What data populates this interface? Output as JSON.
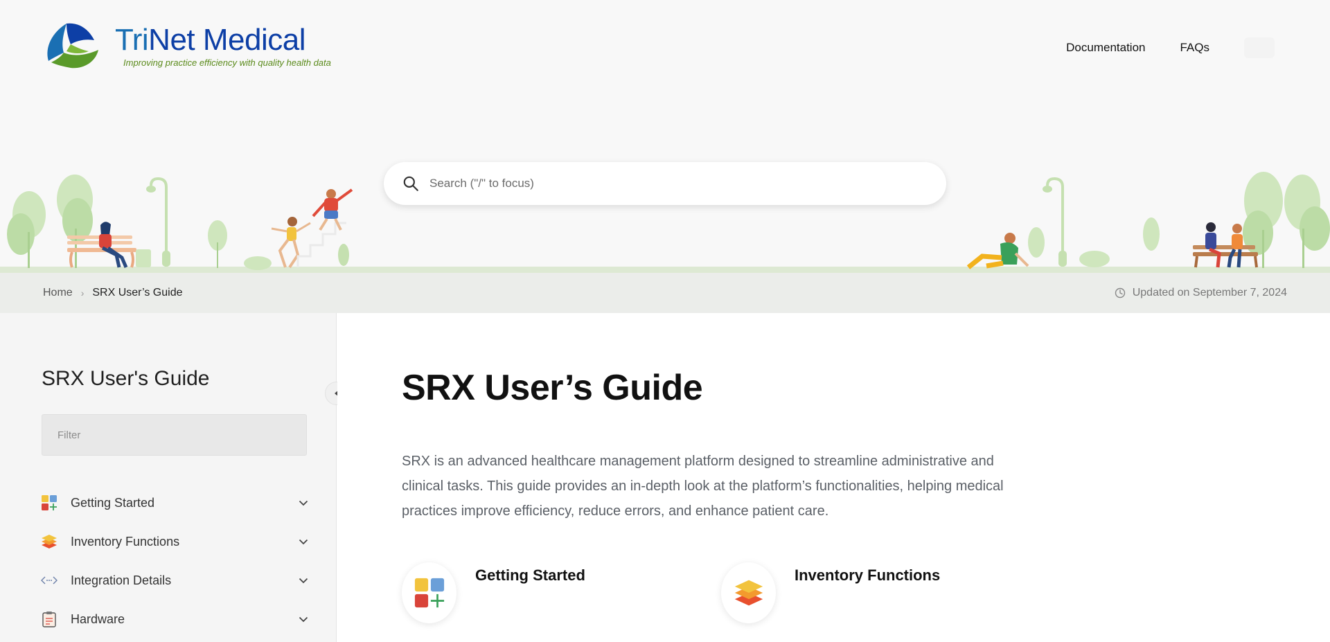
{
  "header": {
    "logo_title_prefix": "Tri",
    "logo_title_rest": "Net Medical",
    "logo_tagline": "Improving practice efficiency with quality health data",
    "nav": [
      {
        "label": "Documentation"
      },
      {
        "label": "FAQs"
      }
    ]
  },
  "search": {
    "placeholder": "Search (\"/\" to focus)",
    "icon": "search-icon"
  },
  "breadcrumb": {
    "home": "Home",
    "separator": "›",
    "current": "SRX User’s Guide",
    "updated": "Updated on September 7, 2024"
  },
  "sidebar": {
    "title": "SRX User's Guide",
    "filter_placeholder": "Filter",
    "items": [
      {
        "label": "Getting Started",
        "icon": "blocks-icon"
      },
      {
        "label": "Inventory Functions",
        "icon": "layers-icon"
      },
      {
        "label": "Integration Details",
        "icon": "code-arrows-icon"
      },
      {
        "label": "Hardware",
        "icon": "clipboard-icon"
      }
    ]
  },
  "main": {
    "title": "SRX User’s Guide",
    "intro": "SRX is an advanced healthcare management platform designed to streamline administrative and clinical tasks. This guide provides an in-depth look at the platform’s functionalities, helping medical practices improve efficiency, reduce errors, and enhance patient care.",
    "cards": [
      {
        "title": "Getting Started",
        "icon": "blocks-icon"
      },
      {
        "title": "Inventory Functions",
        "icon": "layers-icon"
      }
    ]
  },
  "colors": {
    "brand_blue": "#0d3fa6",
    "brand_green": "#5a8a1a",
    "hero_bg": "#f8f8f8",
    "breadcrumb_bg": "#ebedea",
    "sidebar_bg": "#f5f5f5"
  }
}
